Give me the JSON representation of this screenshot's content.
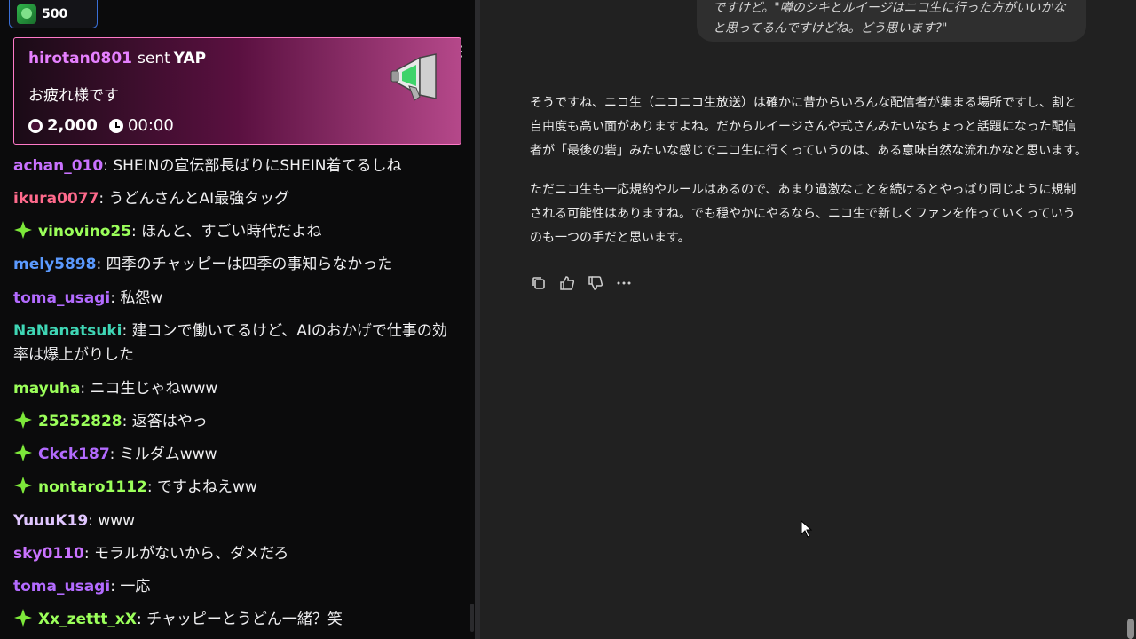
{
  "chat": {
    "points_chip": {
      "value": "500"
    },
    "highlight": {
      "user": "hirotan0801",
      "sent": "sent",
      "item": "YAP",
      "message": "お疲れ様です",
      "cost": "2,000",
      "time": "00:00"
    },
    "messages": [
      {
        "user": "achan_010",
        "color": "#c972ff",
        "badge": false,
        "text": ": SHEINの宣伝部長ばりにSHEIN着てるしね"
      },
      {
        "user": "ikura0077",
        "color": "#ff6a8c",
        "badge": false,
        "text": ": うどんさんとAI最強タッグ"
      },
      {
        "user": "vinovino25",
        "color": "#9bff5a",
        "badge": true,
        "text": ": ほんと、すごい時代だよね"
      },
      {
        "user": "mely5898",
        "color": "#5b9aff",
        "badge": false,
        "text": ": 四季のチャッピーは四季の事知らなかった"
      },
      {
        "user": "toma_usagi",
        "color": "#b36bff",
        "badge": false,
        "text": ": 私怨w"
      },
      {
        "user": "NaNanatsuki",
        "color": "#3fd6b5",
        "badge": false,
        "text": ": 建コンで働いてるけど、AIのおかげで仕事の効率は爆上がりした"
      },
      {
        "user": "mayuha",
        "color": "#9bff5a",
        "badge": false,
        "text": ": ニコ生じゃねwww"
      },
      {
        "user": "25252828",
        "color": "#9bff5a",
        "badge": true,
        "text": ": 返答はやっ"
      },
      {
        "user": "Ckck187",
        "color": "#b36bff",
        "badge": true,
        "text": ": ミルダムwww"
      },
      {
        "user": "nontaro1112",
        "color": "#9bff5a",
        "badge": true,
        "text": ": ですよねえww"
      },
      {
        "user": "YuuuK19",
        "color": "#e0c6ff",
        "badge": false,
        "text": ": www"
      },
      {
        "user": "sky0110",
        "color": "#c972ff",
        "badge": false,
        "text": ": モラルがないから、ダメだろ"
      },
      {
        "user": "toma_usagi",
        "color": "#b36bff",
        "badge": false,
        "text": ": 一応"
      },
      {
        "user": "Xx_zettt_xX",
        "color": "#9bff5a",
        "badge": true,
        "text": ": チャッピーとうどん一緒？笑"
      }
    ]
  },
  "assistant": {
    "user_message": "ですけど。\"噂のシキとルイージはニコ生に行った方がいいかなと思ってるんですけどね。どう思います?\"",
    "reply_paragraphs": [
      "そうですね、ニコ生（ニコニコ生放送）は確かに昔からいろんな配信者が集まる場所ですし、割と自由度も高い面がありますよね。だからルイージさんや式さんみたいなちょっと話題になった配信者が「最後の砦」みたいな感じでニコ生に行くっていうのは、ある意味自然な流れかなと思います。",
      "ただニコ生も一応規約やルールはあるので、あまり過激なことを続けるとやっぱり同じように規制される可能性はありますね。でも穏やかにやるなら、ニコ生で新しくファンを作っていくっていうのも一つの手だと思います。"
    ],
    "actions": [
      "copy-icon",
      "thumbs-up-icon",
      "thumbs-down-icon",
      "more-icon"
    ]
  }
}
